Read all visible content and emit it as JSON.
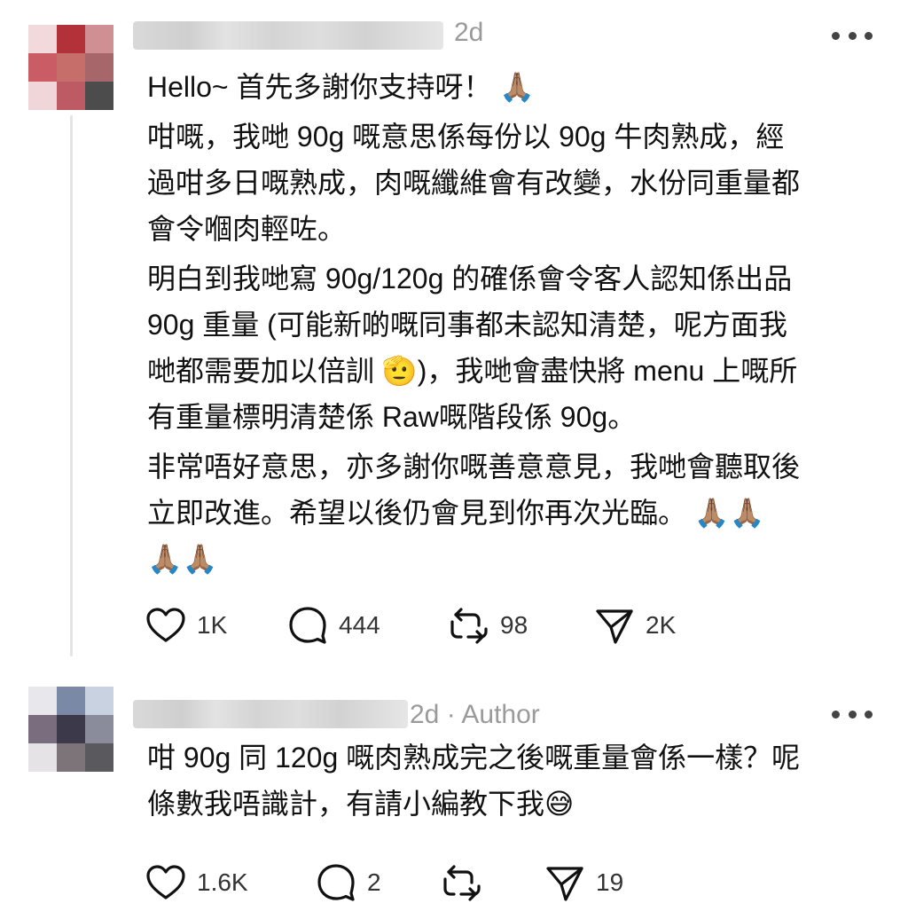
{
  "posts": [
    {
      "meta": "2d",
      "body": [
        [
          "Hello~ 首先多謝你支持呀！ 🙏🏽"
        ],
        [
          "咁嘅，我哋 90g 嘅意思係每份以 90g 牛肉熟成，經",
          "過咁多日嘅熟成，肉嘅纖維會有改變，水份同重量都",
          "會令嗰肉輕咗。"
        ],
        [
          "明白到我哋寫 90g/120g 的確係會令客人認知係出品",
          "90g 重量 (可能新啲嘅同事都未認知清楚，呢方面我",
          "哋都需要加以倍訓 🫡)，我哋會盡快將 menu 上嘅所",
          "有重量標明清楚係 Raw嘅階段係 90g。"
        ],
        [
          "非常唔好意思，亦多謝你嘅善意意見，我哋會聽取後",
          "立即改進。希望以後仍會見到你再次光臨。 🙏🏽🙏🏽",
          "🙏🏽🙏🏽"
        ]
      ],
      "like_count": "1K",
      "reply_count": "444",
      "repost_count": "98",
      "share_count": "2K"
    },
    {
      "meta": "2d · Author",
      "body": [
        [
          "咁 90g 同 120g 嘅肉熟成完之後嘅重量會係一樣？呢",
          "條數我唔識計，有請小編教下我😅"
        ]
      ],
      "like_count": "1.6K",
      "reply_count": "2",
      "repost_count": "",
      "share_count": "19"
    }
  ],
  "icons": {
    "like": "heart-icon",
    "reply": "comment-bubble-icon",
    "repost": "repost-icon",
    "share": "send-icon",
    "more": "more-horizontal-icon"
  }
}
